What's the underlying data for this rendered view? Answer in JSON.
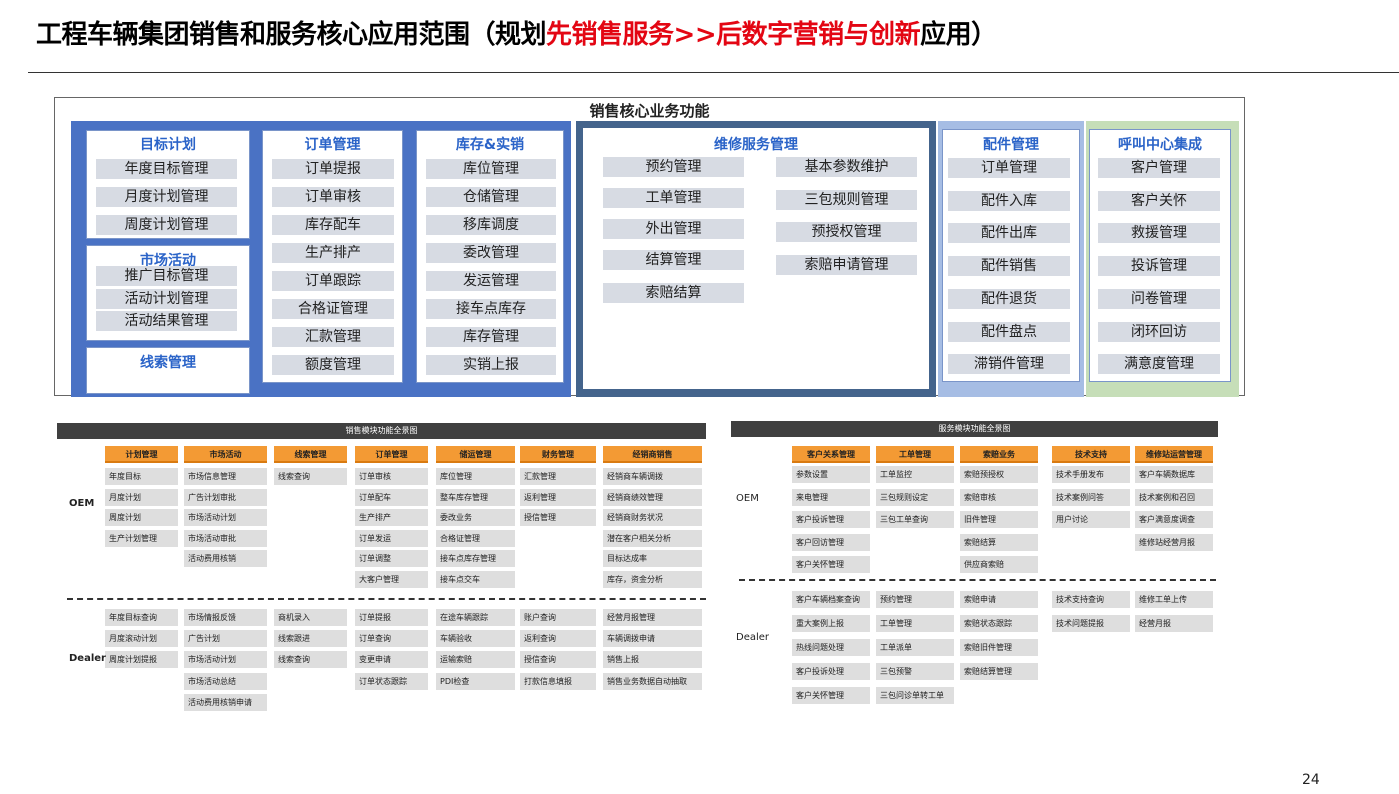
{
  "title": {
    "prefix": "工程车辆集团销售和服务核心应用范围（规划",
    "red1": "先销售服务",
    "arrows": ">>",
    "red2": "后数字营销与创新",
    "suffix": "应用）"
  },
  "core": {
    "heading": "销售核心业务功能",
    "target": {
      "title": "目标计划",
      "items": [
        "年度目标管理",
        "月度计划管理",
        "周度计划管理"
      ]
    },
    "market": {
      "title": "市场活动",
      "items": [
        "推广目标管理",
        "活动计划管理",
        "活动结果管理"
      ]
    },
    "leads": {
      "title": "线索管理"
    },
    "order": {
      "title": "订单管理",
      "items": [
        "订单提报",
        "订单审核",
        "库存配车",
        "生产排产",
        "订单跟踪",
        "合格证管理",
        "汇款管理",
        "额度管理"
      ]
    },
    "stock": {
      "title": "库存&实销",
      "items": [
        "库位管理",
        "仓储管理",
        "移库调度",
        "委改管理",
        "发运管理",
        "接车点库存",
        "库存管理",
        "实销上报"
      ]
    },
    "repair": {
      "title": "维修服务管理",
      "left": [
        "预约管理",
        "工单管理",
        "外出管理",
        "结算管理",
        "索赔结算"
      ],
      "right": [
        "基本参数维护",
        "三包规则管理",
        "预授权管理",
        "索赔申请管理"
      ]
    },
    "parts": {
      "title": "配件管理",
      "items": [
        "订单管理",
        "配件入库",
        "配件出库",
        "配件销售",
        "配件退货",
        "配件盘点",
        "滞销件管理"
      ]
    },
    "callcenter": {
      "title": "呼叫中心集成",
      "items": [
        "客户管理",
        "客户关怀",
        "救援管理",
        "投诉管理",
        "问卷管理",
        "闭环回访",
        "满意度管理"
      ]
    }
  },
  "sales_map": {
    "header": "销售模块功能全景图",
    "oem_label": "OEM",
    "dealer_label": "Dealer",
    "columns": [
      {
        "title": "计划管理",
        "oem": [
          "年度目标",
          "月度计划",
          "周度计划",
          "生产计划管理"
        ],
        "dealer": [
          "年度目标查询",
          "月度滚动计划",
          "周度计划提报"
        ]
      },
      {
        "title": "市场活动",
        "oem": [
          "市场信息管理",
          "广告计划审批",
          "市场活动计划",
          "市场活动审批",
          "活动费用核销"
        ],
        "dealer": [
          "市场情报反馈",
          "广告计划",
          "市场活动计划",
          "市场活动总结",
          "活动费用核销申请"
        ]
      },
      {
        "title": "线索管理",
        "oem": [
          "线索查询"
        ],
        "dealer": [
          "商机录入",
          "线索跟进",
          "线索查询"
        ]
      },
      {
        "title": "订单管理",
        "oem": [
          "订单审核",
          "订单配车",
          "生产排产",
          "订单发运",
          "订单调整",
          "大客户管理"
        ],
        "dealer": [
          "订单提报",
          "订单查询",
          "变更申请",
          "订单状态跟踪"
        ]
      },
      {
        "title": "储运管理",
        "oem": [
          "库位管理",
          "整车库存管理",
          "委改业务",
          "合格证管理",
          "接车点库存管理",
          "接车点交车"
        ],
        "dealer": [
          "在途车辆跟踪",
          "车辆验收",
          "运输索赔",
          "PDI检查"
        ]
      },
      {
        "title": "财务管理",
        "oem": [
          "汇款管理",
          "返利管理",
          "授信管理"
        ],
        "dealer": [
          "账户查询",
          "返利查询",
          "授信查询",
          "打款信息填报"
        ]
      },
      {
        "title": "经销商销售",
        "oem": [
          "经销商车辆调拨",
          "经销商绩效管理",
          "经销商财务状况",
          "潜在客户相关分析",
          "目标达成率",
          "库存，资金分析"
        ],
        "dealer": [
          "经营月报管理",
          "车辆调拨申请",
          "销售上报",
          "销售业务数据自动抽取"
        ]
      }
    ]
  },
  "service_map": {
    "header": "服务模块功能全景图",
    "oem_label": "OEM",
    "dealer_label": "Dealer",
    "columns": [
      {
        "title": "客户关系管理",
        "oem": [
          "参数设置",
          "来电管理",
          "客户投诉管理",
          "客户回访管理",
          "客户关怀管理"
        ],
        "dealer": [
          "客户车辆档案查询",
          "重大案例上报",
          "热线问题处理",
          "客户投诉处理",
          "客户关怀管理"
        ]
      },
      {
        "title": "工单管理",
        "oem": [
          "工单监控",
          "三包规则设定",
          "三包工单查询"
        ],
        "dealer": [
          "预约管理",
          "工单管理",
          "工单派单",
          "三包预警",
          "三包问诊单转工单"
        ]
      },
      {
        "title": "索赔业务",
        "oem": [
          "索赔预授权",
          "索赔审核",
          "旧件管理",
          "索赔结算",
          "供应商索赔"
        ],
        "dealer": [
          "索赔申请",
          "索赔状态跟踪",
          "索赔旧件管理",
          "索赔结算管理"
        ]
      },
      {
        "title": "技术支持",
        "oem": [
          "技术手册发布",
          "技术案例问答",
          "用户讨论"
        ],
        "dealer": [
          "技术支持查询",
          "技术问题提报"
        ]
      },
      {
        "title": "维修站运营管理",
        "oem": [
          "客户车辆数据库",
          "技术案例和召回",
          "客户满意度调查",
          "维修站经营月报"
        ],
        "dealer": [
          "维修工单上传",
          "经营月报"
        ]
      }
    ]
  },
  "page_number": "24"
}
